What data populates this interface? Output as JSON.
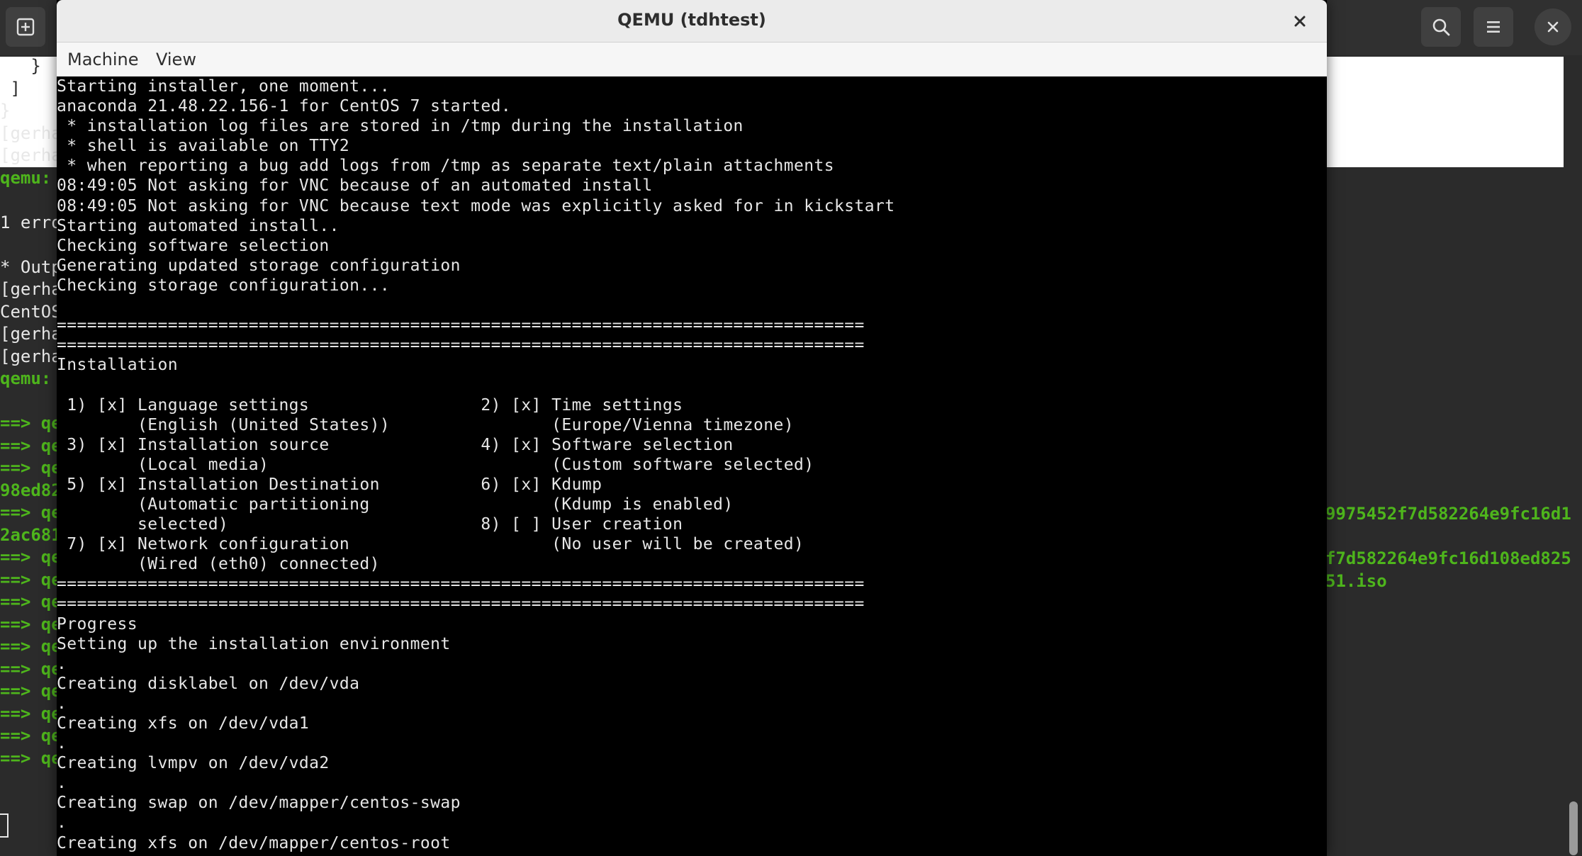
{
  "terminal": {
    "new_tab_icon": "new-tab-icon",
    "search_icon": "search-icon",
    "menu_icon": "hamburger-menu-icon",
    "close_icon": "close-icon",
    "left_fragments": [
      {
        "text": "   }",
        "color": "black"
      },
      {
        "text": " ]",
        "color": "black"
      },
      {
        "text": "}",
        "color": "white"
      },
      {
        "text": "[gerha",
        "color": "white"
      },
      {
        "text": "[gerha",
        "color": "white"
      },
      {
        "text": "qemu:",
        "color": "green"
      },
      {
        "text": "",
        "color": "white"
      },
      {
        "text": "1 erro",
        "color": "white"
      },
      {
        "text": "",
        "color": "white"
      },
      {
        "text": "* Outp",
        "color": "white"
      },
      {
        "text": "[gerha",
        "color": "white"
      },
      {
        "text": "CentOS",
        "color": "white"
      },
      {
        "text": "[gerha",
        "color": "white"
      },
      {
        "text": "[gerha",
        "color": "white"
      },
      {
        "text": "qemu:",
        "color": "green"
      },
      {
        "text": "",
        "color": "white"
      },
      {
        "text": "==> qe",
        "color": "green"
      },
      {
        "text": "==> qe",
        "color": "green"
      },
      {
        "text": "==> qe",
        "color": "green"
      },
      {
        "text": "98ed82",
        "color": "green"
      },
      {
        "text": "==> qe",
        "color": "green"
      },
      {
        "text": "2ac681",
        "color": "green"
      },
      {
        "text": "==> qe",
        "color": "green"
      },
      {
        "text": "==> qe",
        "color": "green"
      },
      {
        "text": "==> qe",
        "color": "green"
      },
      {
        "text": "==> qe",
        "color": "green"
      },
      {
        "text": "==> qe",
        "color": "green"
      },
      {
        "text": "==> qe",
        "color": "green"
      },
      {
        "text": "==> qe",
        "color": "green"
      },
      {
        "text": "==> qe",
        "color": "green"
      },
      {
        "text": "==> qe",
        "color": "green"
      },
      {
        "text": "==> qe",
        "color": "green"
      }
    ],
    "right_fragments": [
      "9975452f7d582264e9fc16d1",
      "",
      "f7d582264e9fc16d108ed825",
      "51.iso"
    ]
  },
  "qemu": {
    "title": "QEMU (tdhtest)",
    "close_label": "×",
    "menu": [
      "Machine",
      "View"
    ],
    "console_lines": [
      "Starting installer, one moment...",
      "anaconda 21.48.22.156-1 for CentOS 7 started.",
      " * installation log files are stored in /tmp during the installation",
      " * shell is available on TTY2",
      " * when reporting a bug add logs from /tmp as separate text/plain attachments",
      "08:49:05 Not asking for VNC because of an automated install",
      "08:49:05 Not asking for VNC because text mode was explicitly asked for in kickstart",
      "Starting automated install..",
      "Checking software selection",
      "Generating updated storage configuration",
      "Checking storage configuration...",
      "",
      "================================================================================",
      "================================================================================",
      "Installation",
      "",
      " 1) [x] Language settings                 2) [x] Time settings",
      "        (English (United States))                (Europe/Vienna timezone)",
      " 3) [x] Installation source               4) [x] Software selection",
      "        (Local media)                            (Custom software selected)",
      " 5) [x] Installation Destination          6) [x] Kdump",
      "        (Automatic partitioning                  (Kdump is enabled)",
      "        selected)                         8) [ ] User creation",
      " 7) [x] Network configuration                    (No user will be created)",
      "        (Wired (eth0) connected)",
      "================================================================================",
      "================================================================================",
      "Progress",
      "Setting up the installation environment",
      ".",
      "Creating disklabel on /dev/vda",
      ".",
      "Creating xfs on /dev/vda1",
      ".",
      "Creating lvmpv on /dev/vda2",
      ".",
      "Creating swap on /dev/mapper/centos-swap",
      ".",
      "Creating xfs on /dev/mapper/centos-root"
    ]
  }
}
